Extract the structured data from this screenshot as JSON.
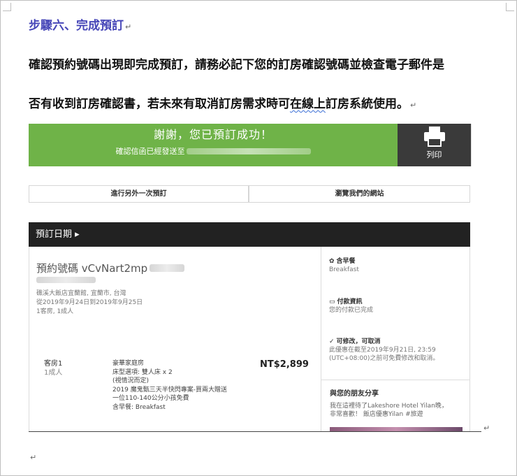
{
  "document": {
    "step_heading": "步驟六、完成預訂",
    "para_line1": "確認預約號碼出現即完成預訂，請務必記下您的訂房確認號碼並檢查電子郵件是",
    "para_line2_a": "否有收到訂房確認書，若未來有取消訂房需求時可",
    "para_line2_b": "在線上",
    "para_line2_c": "訂房系統使用。",
    "paragraph_mark": "↵"
  },
  "confirmation": {
    "thanks": "謝謝，您已預訂成功！",
    "sent_to": "確認信函已經發送至",
    "print_label": "列印",
    "book_another": "進行另外一次預訂",
    "browse_site": "瀏覽我們的網站",
    "booking_dates": "預訂日期 ▸"
  },
  "reservation": {
    "number_label": "預約號碼 vCvNart2mp",
    "hotel_line": "礁溪大飯店宜蘭館, 宜蘭市, 台灣",
    "date_line": "從2019年9月24日到2019年9月25日",
    "guest_line": "1客房, 1成人",
    "room_label": "客房1",
    "room_guests": "1成人",
    "room_name": "豪華家庭房",
    "bed_type": "床型選項: 雙人床 x 2",
    "bed_note": "(視情況而定)",
    "promo_1": "2019 魔鬼甄三天半快閃專案-買兩大贈送",
    "promo_2": "一位110-140公分小孩免費",
    "meal": "含早餐: Breakfast",
    "price": "NT$2,899"
  },
  "sidebar": {
    "breakfast_head": "含早餐",
    "breakfast_sub": "Breakfast",
    "payment_head": "付款資訊",
    "payment_sub": "您的付款已完成",
    "cancel_head": "可修改，可取消",
    "cancel_line1": "此優惠在截至2019年9月21日, 23:59",
    "cancel_line2": "(UTC+08:00)之前可免費修改和取消。",
    "share_head": "與您的朋友分享",
    "share_line1": "我在這裡待了Lakeshore Hotel Yilan晚，",
    "share_line2": "非常喜歡！ 飯店優惠Yilan #旅遊"
  },
  "colors": {
    "heading_blue": "#4747b8",
    "banner_green": "#6fb348",
    "print_dark": "#3a3a3a",
    "date_bar": "#222222"
  }
}
